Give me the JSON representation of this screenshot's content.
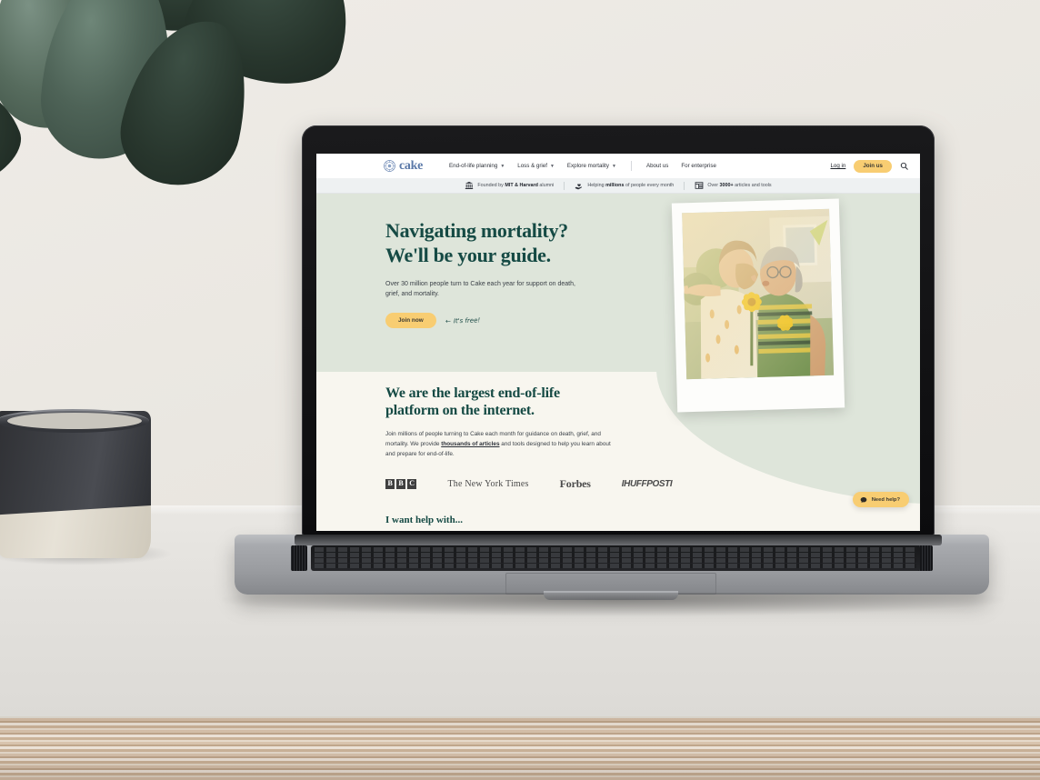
{
  "scene": {
    "description": "laptop-on-desk-mockup",
    "wall_color": "#eae7e1",
    "desk_color": "#e3e1dd",
    "plywood_color": "#d9c4ae",
    "plant_label": "monstera-leaves",
    "mug_label": "ceramic-mug"
  },
  "site": {
    "brand": {
      "wordmark": "cake",
      "mark_name": "cake-medallion-logo",
      "color": "#5b79a8"
    },
    "nav": {
      "links": [
        {
          "label": "End-of-life planning",
          "has_dropdown": true
        },
        {
          "label": "Loss & grief",
          "has_dropdown": true
        },
        {
          "label": "Explore mortality",
          "has_dropdown": true
        },
        {
          "label": "About us",
          "has_dropdown": false
        },
        {
          "label": "For enterprise",
          "has_dropdown": false
        }
      ],
      "login_label": "Log in",
      "join_label": "Join us",
      "search_icon": "search-icon"
    },
    "trustbar": [
      {
        "icon": "bank-columns-icon",
        "prefix": "Founded by ",
        "bold": "MIT & Harvard",
        "suffix": " alumni"
      },
      {
        "icon": "hand-heart-icon",
        "prefix": "Helping ",
        "bold": "millions",
        "suffix": " of people every month"
      },
      {
        "icon": "article-grid-icon",
        "prefix": "Over ",
        "bold": "3000+",
        "suffix": " articles and tools"
      }
    ],
    "hero": {
      "title_line1": "Navigating mortality?",
      "title_line2": "We'll be your guide.",
      "subtitle": "Over 30 million people turn to Cake each year for support on death, grief, and mortality.",
      "cta_label": "Join now",
      "free_note": "It's free!",
      "arrow": "←",
      "bg_color": "#dee5da",
      "title_color": "#154a44",
      "cta_color": "#f8cd72",
      "photo_alt": "child-kissing-grandmother-polaroid"
    },
    "about": {
      "title_line1": "We are the largest end-of-life",
      "title_line2": "platform on the internet.",
      "body_part1": "Join millions of people turning to Cake each month for guidance on death, grief, and mortality. We provide ",
      "body_link": "thousands of articles",
      "body_part2": " and tools designed to help you learn about and prepare for end-of-life.",
      "bg_color": "#f8f6ef"
    },
    "press": {
      "bbc": [
        "B",
        "B",
        "C"
      ],
      "nyt": "The New York Times",
      "forbes": "Forbes",
      "huffpost": "IHUFFPOSTI"
    },
    "help_section": {
      "title": "I want help with..."
    },
    "chat": {
      "label": "Need help?",
      "icon": "chat-bubble-icon",
      "color": "#f8cd72"
    }
  }
}
